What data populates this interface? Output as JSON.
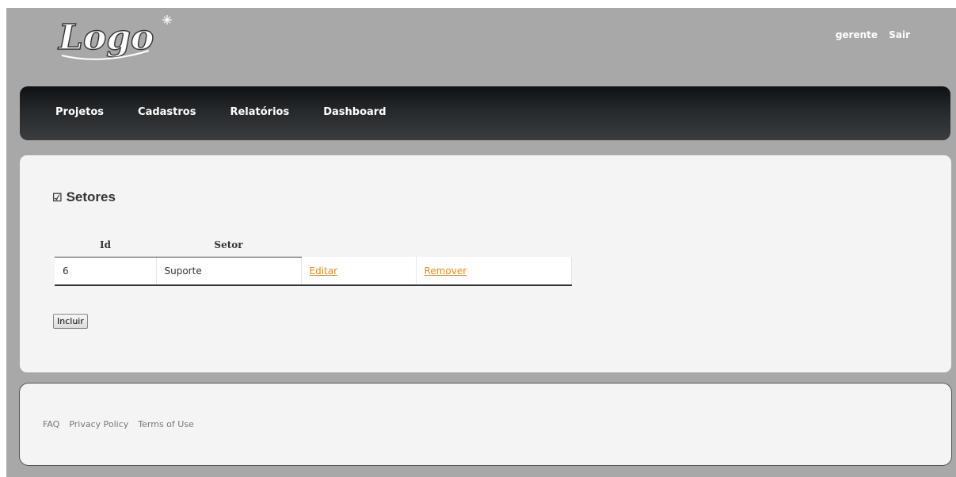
{
  "header": {
    "logo_text": "Logo",
    "user_name": "gerente",
    "logout_label": "Sair"
  },
  "nav": {
    "items": [
      {
        "label": "Projetos"
      },
      {
        "label": "Cadastros"
      },
      {
        "label": "Relatórios"
      },
      {
        "label": "Dashboard"
      }
    ]
  },
  "section": {
    "title": "Setores",
    "table": {
      "columns": [
        "Id",
        "Setor"
      ],
      "rows": [
        {
          "id": "6",
          "setor": "Suporte",
          "edit_label": "Editar",
          "remove_label": "Remover"
        }
      ]
    },
    "add_button_label": "Incluir"
  },
  "footer": {
    "links": [
      {
        "label": "FAQ"
      },
      {
        "label": "Privacy Policy"
      },
      {
        "label": "Terms of Use"
      }
    ]
  },
  "colors": {
    "background": "#a8a8a8",
    "navbar": "#26292c",
    "panel": "#f4f4f4",
    "link": "#e88a1a"
  }
}
